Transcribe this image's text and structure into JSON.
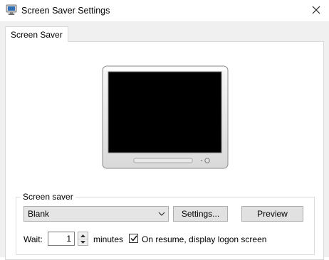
{
  "window": {
    "title": "Screen Saver Settings"
  },
  "tabs": [
    {
      "label": "Screen Saver"
    }
  ],
  "screen_saver": {
    "group_label": "Screen saver",
    "selected": "Blank",
    "settings_label": "Settings...",
    "preview_label": "Preview",
    "wait_label": "Wait:",
    "wait_value": "1",
    "minutes_label": "minutes",
    "resume_label": "On resume, display logon screen",
    "resume_checked": true
  },
  "icons": {
    "app": "monitor-icon",
    "close": "close-icon",
    "dropdown": "chevron-down-icon",
    "spin_up": "arrow-up-icon",
    "spin_down": "arrow-down-icon",
    "check": "checkmark-icon"
  }
}
